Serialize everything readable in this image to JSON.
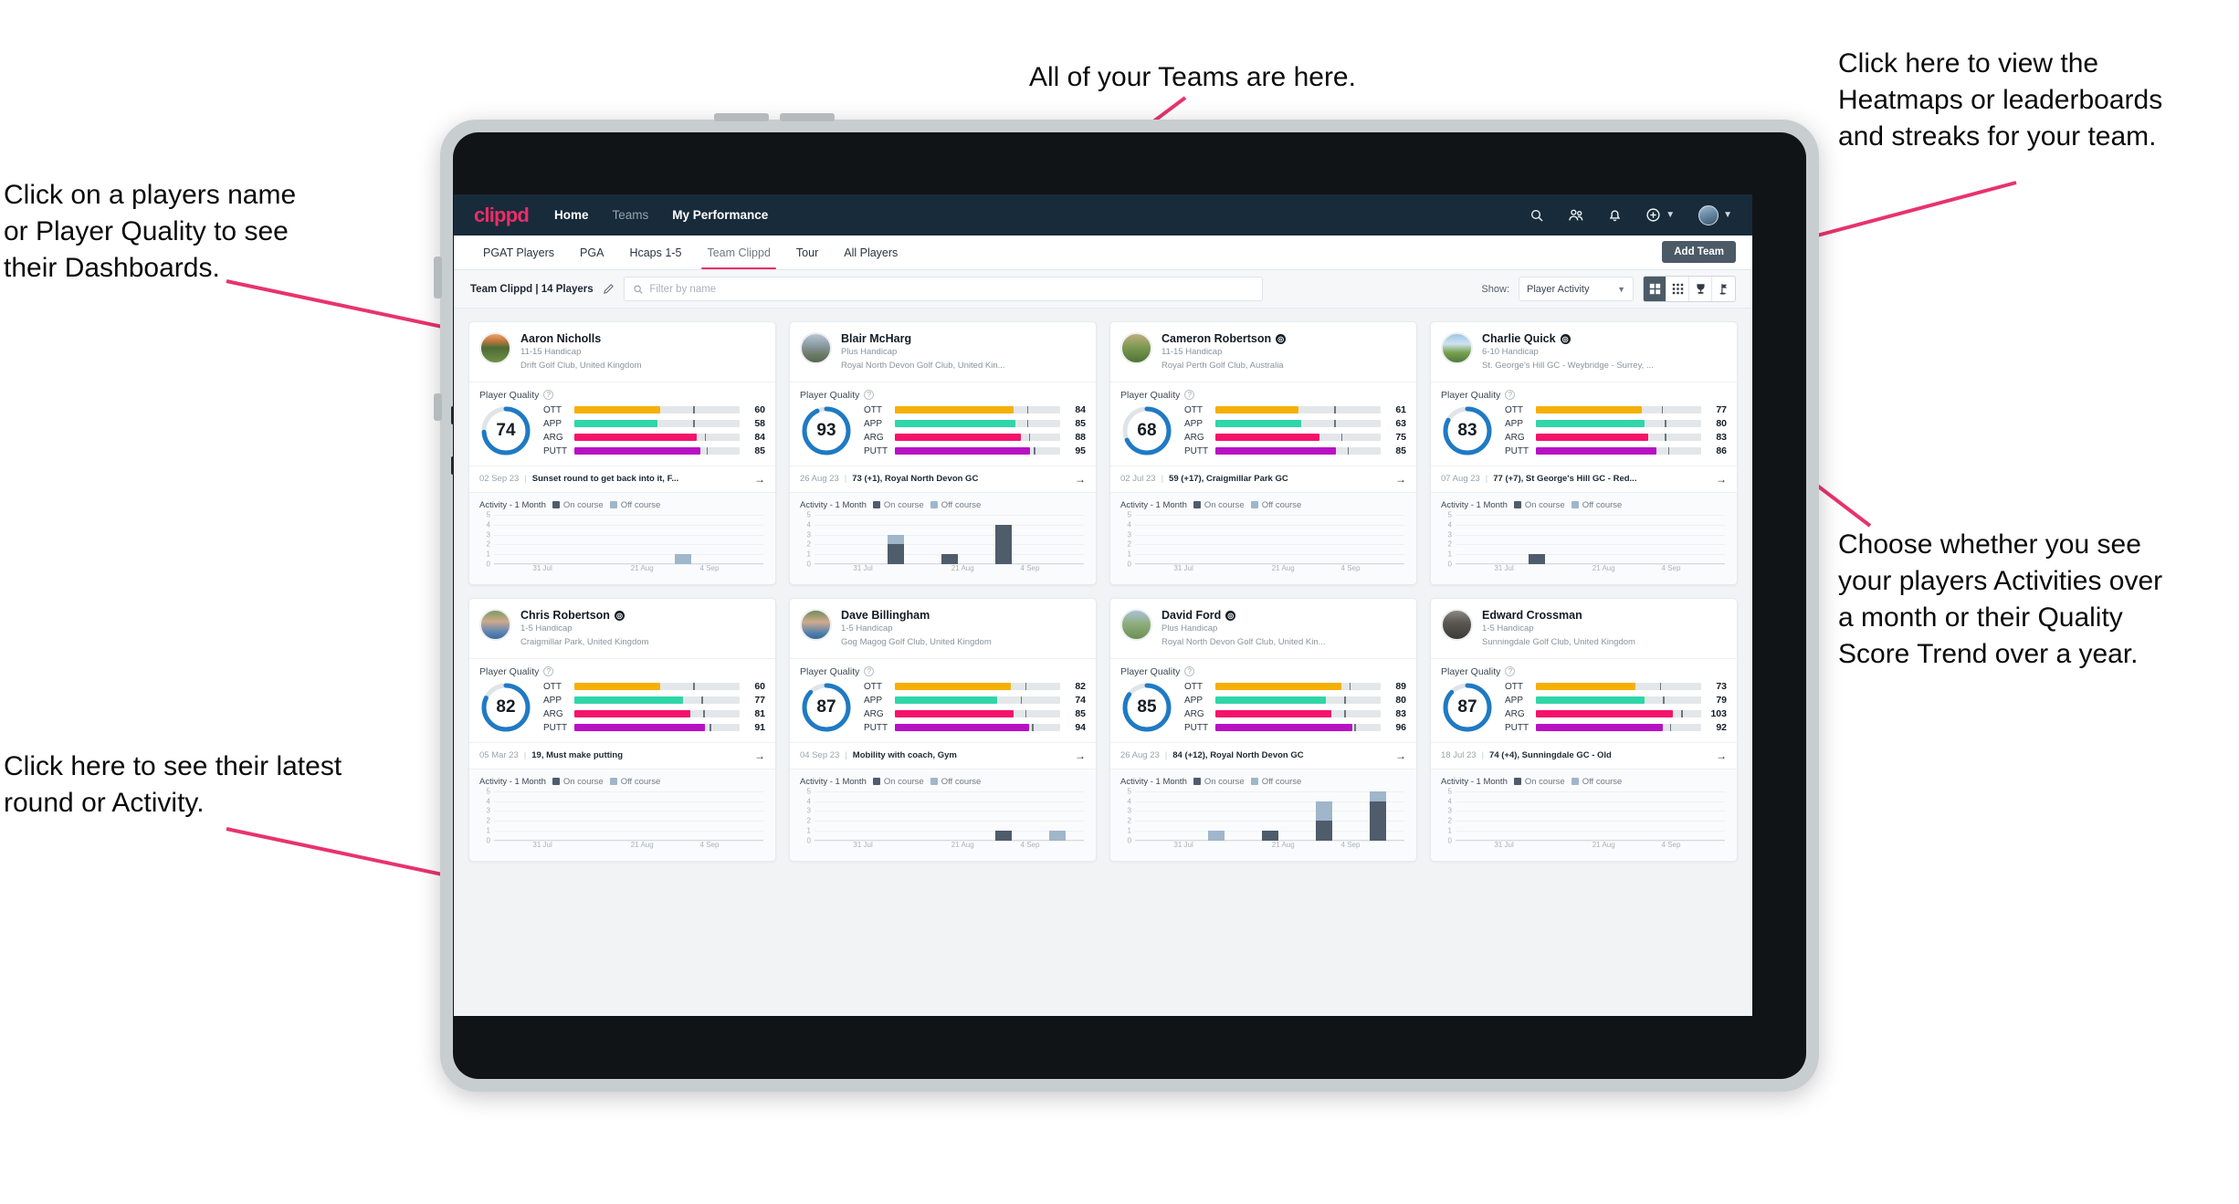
{
  "annotations": [
    {
      "id": "a-top",
      "text": "All of your Teams are here."
    },
    {
      "id": "a-right1",
      "text": "Click here to view the\nHeatmaps or leaderboards\nand streaks for your team."
    },
    {
      "id": "a-left1",
      "text": "Click on a players name\nor Player Quality to see\ntheir Dashboards."
    },
    {
      "id": "a-right2",
      "text": "Choose whether you see\nyour players Activities over\na month or their Quality\nScore Trend over a year."
    },
    {
      "id": "a-left2",
      "text": "Click here to see their latest\nround or Activity."
    }
  ],
  "colors": {
    "brand_pink": "#ec2d68",
    "nav_dark": "#172b3a",
    "ring_blue": "#1f7ac4",
    "ott": "#f5b007",
    "app": "#2fd6a8",
    "arg": "#f4136b",
    "putt": "#b811c4",
    "on_course": "#4e5c6b",
    "off_course": "#9fb6cb",
    "arrow_pink": "#e8336d"
  },
  "nav": {
    "logo": "clippd",
    "links": [
      {
        "label": "Home",
        "active": true
      },
      {
        "label": "Teams",
        "active": false
      },
      {
        "label": "My Performance",
        "active": true
      }
    ],
    "icons": [
      {
        "name": "search-icon"
      },
      {
        "name": "people-icon"
      },
      {
        "name": "bell-icon"
      },
      {
        "name": "add-circle-icon"
      },
      {
        "name": "avatar-icon"
      }
    ]
  },
  "tabs": [
    {
      "label": "PGAT Players",
      "active": false
    },
    {
      "label": "PGA",
      "active": false
    },
    {
      "label": "Hcaps 1-5",
      "active": false
    },
    {
      "label": "Team Clippd",
      "active": true
    },
    {
      "label": "Tour",
      "active": false
    },
    {
      "label": "All Players",
      "active": false
    }
  ],
  "add_team_label": "Add Team",
  "toolbar": {
    "team_label": "Team Clippd | 14 Players",
    "search_placeholder": "Filter by name",
    "search_value": "",
    "show_label": "Show:",
    "show_value": "Player Activity",
    "views": [
      {
        "name": "grid-view-icon",
        "active": true
      },
      {
        "name": "dense-grid-view-icon",
        "active": false
      },
      {
        "name": "trophy-view-icon",
        "active": false
      },
      {
        "name": "golf-flag-view-icon",
        "active": false
      }
    ]
  },
  "card_labels": {
    "player_quality": "Player Quality",
    "activity": "Activity - 1 Month",
    "on_course": "On course",
    "off_course": "Off course",
    "metrics": [
      "OTT",
      "APP",
      "ARG",
      "PUTT"
    ],
    "x_ticks": [
      "31 Jul",
      "21 Aug",
      "4 Sep"
    ],
    "y_ticks": [
      "5",
      "4",
      "3",
      "2",
      "1",
      "0"
    ]
  },
  "players": [
    {
      "name": "Aaron Nicholls",
      "verified": false,
      "handicap": "11-15 Handicap",
      "club": "Drift Golf Club, United Kingdom",
      "quality": 74,
      "metrics": [
        {
          "label": "OTT",
          "value": 60,
          "fill": 52,
          "tick": 72
        },
        {
          "label": "APP",
          "value": 58,
          "fill": 50,
          "tick": 72
        },
        {
          "label": "ARG",
          "value": 84,
          "fill": 74,
          "tick": 79
        },
        {
          "label": "PUTT",
          "value": 85,
          "fill": 76,
          "tick": 80
        }
      ],
      "round_date": "02 Sep 23",
      "round_text": "Sunset round to get back into it, F...",
      "avatar": "scene-sunset-course",
      "chart": {
        "on": [
          0,
          0,
          0,
          0,
          0
        ],
        "off": [
          0,
          0,
          0,
          1,
          0
        ]
      }
    },
    {
      "name": "Blair McHarg",
      "verified": false,
      "handicap": "Plus Handicap",
      "club": "Royal North Devon Golf Club, United Kin...",
      "quality": 93,
      "metrics": [
        {
          "label": "OTT",
          "value": 84,
          "fill": 72,
          "tick": 80
        },
        {
          "label": "APP",
          "value": 85,
          "fill": 73,
          "tick": 80
        },
        {
          "label": "ARG",
          "value": 88,
          "fill": 76,
          "tick": 81
        },
        {
          "label": "PUTT",
          "value": 95,
          "fill": 82,
          "tick": 84
        }
      ],
      "round_date": "26 Aug 23",
      "round_text": "73 (+1), Royal North Devon GC",
      "avatar": "scene-links-statue",
      "chart": {
        "on": [
          0,
          2,
          1,
          4,
          0
        ],
        "off": [
          0,
          1,
          0,
          0,
          0
        ]
      }
    },
    {
      "name": "Cameron Robertson",
      "verified": true,
      "handicap": "11-15 Handicap",
      "club": "Royal Perth Golf Club, Australia",
      "quality": 68,
      "metrics": [
        {
          "label": "OTT",
          "value": 61,
          "fill": 50,
          "tick": 72
        },
        {
          "label": "APP",
          "value": 63,
          "fill": 52,
          "tick": 72
        },
        {
          "label": "ARG",
          "value": 75,
          "fill": 63,
          "tick": 76
        },
        {
          "label": "PUTT",
          "value": 85,
          "fill": 73,
          "tick": 80
        }
      ],
      "round_date": "02 Jul 23",
      "round_text": "59 (+17), Craigmillar Park GC",
      "avatar": "scene-fairway-tree",
      "chart": {
        "on": [
          0,
          0,
          0,
          0,
          0
        ],
        "off": [
          0,
          0,
          0,
          0,
          0
        ]
      }
    },
    {
      "name": "Charlie Quick",
      "verified": true,
      "handicap": "6-10 Handicap",
      "club": "St. George's Hill GC - Weybridge - Surrey, ...",
      "quality": 83,
      "metrics": [
        {
          "label": "OTT",
          "value": 77,
          "fill": 64,
          "tick": 76
        },
        {
          "label": "APP",
          "value": 80,
          "fill": 66,
          "tick": 78
        },
        {
          "label": "ARG",
          "value": 83,
          "fill": 68,
          "tick": 78
        },
        {
          "label": "PUTT",
          "value": 86,
          "fill": 73,
          "tick": 80
        }
      ],
      "round_date": "07 Aug 23",
      "round_text": "77 (+7), St George's Hill GC - Red...",
      "avatar": "scene-green-sky",
      "chart": {
        "on": [
          0,
          1,
          0,
          0,
          0
        ],
        "off": [
          0,
          0,
          0,
          0,
          0
        ]
      }
    },
    {
      "name": "Chris Robertson",
      "verified": true,
      "handicap": "1-5 Handicap",
      "club": "Craigmillar Park, United Kingdom",
      "quality": 82,
      "metrics": [
        {
          "label": "OTT",
          "value": 60,
          "fill": 52,
          "tick": 72
        },
        {
          "label": "APP",
          "value": 77,
          "fill": 66,
          "tick": 77
        },
        {
          "label": "ARG",
          "value": 81,
          "fill": 70,
          "tick": 78
        },
        {
          "label": "PUTT",
          "value": 91,
          "fill": 79,
          "tick": 82
        }
      ],
      "round_date": "05 Mar 23",
      "round_text": "19, Must make putting",
      "avatar": "portrait-man-blue-shirt",
      "chart": {
        "on": [
          0,
          0,
          0,
          0,
          0
        ],
        "off": [
          0,
          0,
          0,
          0,
          0
        ]
      }
    },
    {
      "name": "Dave Billingham",
      "verified": false,
      "handicap": "1-5 Handicap",
      "club": "Gog Magog Golf Club, United Kingdom",
      "quality": 87,
      "metrics": [
        {
          "label": "OTT",
          "value": 82,
          "fill": 70,
          "tick": 79
        },
        {
          "label": "APP",
          "value": 74,
          "fill": 62,
          "tick": 76
        },
        {
          "label": "ARG",
          "value": 85,
          "fill": 72,
          "tick": 79
        },
        {
          "label": "PUTT",
          "value": 94,
          "fill": 81,
          "tick": 83
        }
      ],
      "round_date": "04 Sep 23",
      "round_text": "Mobility with coach, Gym",
      "avatar": "portrait-man-beard",
      "chart": {
        "on": [
          0,
          0,
          0,
          1,
          0
        ],
        "off": [
          0,
          0,
          0,
          0,
          1
        ]
      }
    },
    {
      "name": "David Ford",
      "verified": true,
      "handicap": "Plus Handicap",
      "club": "Royal North Devon Golf Club, United Kin...",
      "quality": 85,
      "metrics": [
        {
          "label": "OTT",
          "value": 89,
          "fill": 76,
          "tick": 81
        },
        {
          "label": "APP",
          "value": 80,
          "fill": 67,
          "tick": 78
        },
        {
          "label": "ARG",
          "value": 83,
          "fill": 70,
          "tick": 78
        },
        {
          "label": "PUTT",
          "value": 96,
          "fill": 83,
          "tick": 84
        }
      ],
      "round_date": "26 Aug 23",
      "round_text": "84 (+12), Royal North Devon GC",
      "avatar": "scene-hiker-hill",
      "chart": {
        "on": [
          0,
          0,
          1,
          2,
          4
        ],
        "off": [
          0,
          1,
          0,
          2,
          1
        ]
      }
    },
    {
      "name": "Edward Crossman",
      "verified": false,
      "handicap": "1-5 Handicap",
      "club": "Sunningdale Golf Club, United Kingdom",
      "quality": 87,
      "metrics": [
        {
          "label": "OTT",
          "value": 73,
          "fill": 60,
          "tick": 75
        },
        {
          "label": "APP",
          "value": 79,
          "fill": 66,
          "tick": 77
        },
        {
          "label": "ARG",
          "value": 103,
          "fill": 83,
          "tick": 88
        },
        {
          "label": "PUTT",
          "value": 92,
          "fill": 77,
          "tick": 81
        }
      ],
      "round_date": "18 Jul 23",
      "round_text": "74 (+4), Sunningdale GC - Old",
      "avatar": "scene-indoor-people",
      "chart": {
        "on": [
          0,
          0,
          0,
          0,
          0
        ],
        "off": [
          0,
          0,
          0,
          0,
          0
        ]
      }
    }
  ]
}
